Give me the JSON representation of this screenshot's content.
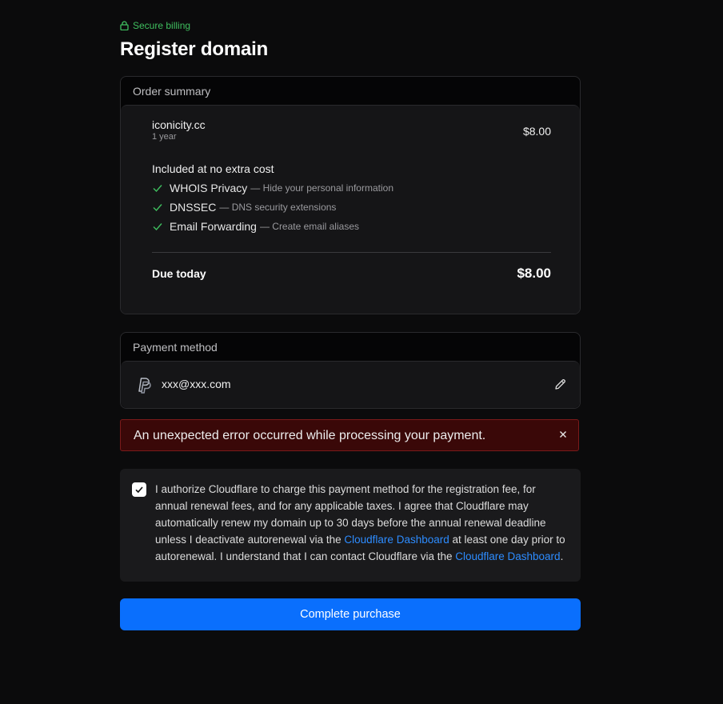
{
  "header": {
    "secure_label": "Secure billing",
    "title": "Register domain"
  },
  "order": {
    "heading": "Order summary",
    "domain": "iconicity.cc",
    "term": "1 year",
    "price": "$8.00",
    "included_title": "Included at no extra cost",
    "features": [
      {
        "name": "WHOIS Privacy",
        "desc": "— Hide your personal information"
      },
      {
        "name": "DNSSEC",
        "desc": "— DNS security extensions"
      },
      {
        "name": "Email Forwarding",
        "desc": "— Create email aliases"
      }
    ],
    "due_label": "Due today",
    "due_amount": "$8.00"
  },
  "payment": {
    "heading": "Payment method",
    "account": "xxx@xxx.com",
    "icon": "paypal-icon"
  },
  "error": {
    "message": "An unexpected error occurred while processing your payment."
  },
  "consent": {
    "checked": true,
    "text_1": "I authorize Cloudflare to charge this payment method for the registration fee, for annual renewal fees, and for any applicable taxes. I agree that Cloudflare may automatically renew my domain up to 30 days before the annual renewal deadline unless I deactivate autorenewal via the ",
    "link_1": "Cloudflare Dashboard",
    "text_2": " at least one day prior to autorenewal. I understand that I can contact Cloudflare via the ",
    "link_2": "Cloudflare Dashboard",
    "text_3": "."
  },
  "actions": {
    "purchase_label": "Complete purchase"
  },
  "colors": {
    "accent": "#0a6ffd",
    "success": "#3fbf5f",
    "error_bg": "#3a0808",
    "link": "#2d8cff"
  }
}
